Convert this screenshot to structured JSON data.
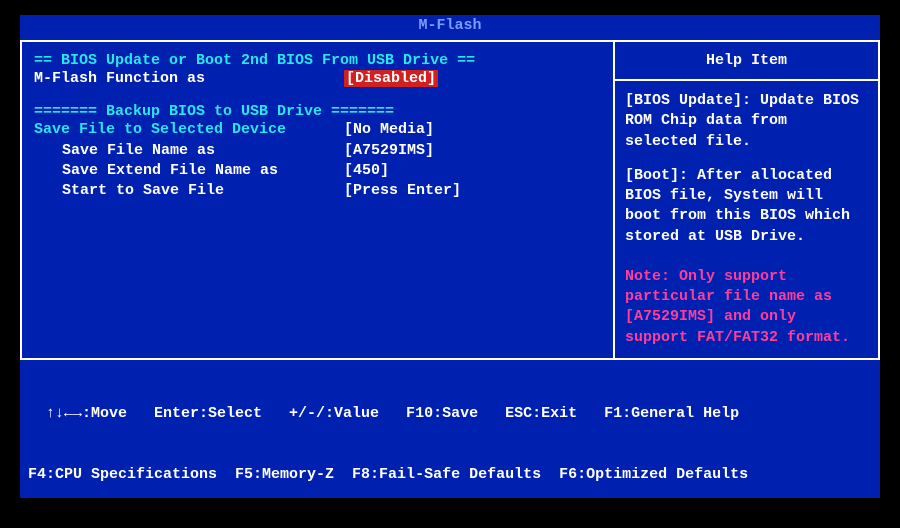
{
  "title": "M-Flash",
  "left": {
    "section1_header": "== BIOS Update or Boot 2nd BIOS From USB Drive ==",
    "mflash_label": "M-Flash Function as",
    "mflash_value": "[Disabled]",
    "section2_header": "======= Backup BIOS to USB Drive =======",
    "save_device_label": "Save File to Selected Device",
    "save_device_value": "[No Media]",
    "save_name_label": "Save File Name as",
    "save_name_value": "[A7529IMS]",
    "save_ext_label": "Save Extend File Name as",
    "save_ext_value": "[450]",
    "start_label": "Start to Save File",
    "start_value": "[Press Enter]"
  },
  "help": {
    "header": "Help Item",
    "body1": "[BIOS Update]: Update BIOS ROM Chip data from selected file.",
    "body2": "[Boot]: After allocated BIOS file, System will boot from this BIOS which stored at USB Drive.",
    "note": "Note: Only support particular file name as [A7529IMS] and only support FAT/FAT32 format."
  },
  "footer": {
    "line1": "  ↑↓←→:Move   Enter:Select   +/-/:Value   F10:Save   ESC:Exit   F1:General Help",
    "line2": "F4:CPU Specifications  F5:Memory-Z  F8:Fail-Safe Defaults  F6:Optimized Defaults"
  }
}
